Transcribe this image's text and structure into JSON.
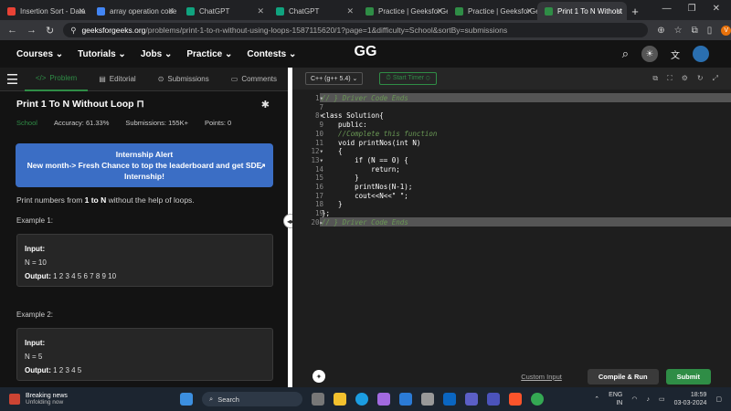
{
  "browser": {
    "tabs": [
      {
        "title": "Insertion Sort - Data",
        "color": "#e94235",
        "active": false
      },
      {
        "title": "array operation code",
        "color": "#4285f4",
        "active": false
      },
      {
        "title": "ChatGPT",
        "color": "#10a37f",
        "active": false
      },
      {
        "title": "ChatGPT",
        "color": "#10a37f",
        "active": false
      },
      {
        "title": "Practice | GeeksforGe",
        "color": "#2f8d46",
        "active": false
      },
      {
        "title": "Practice | GeeksforGe",
        "color": "#2f8d46",
        "active": false
      },
      {
        "title": "Print 1 To N Without",
        "color": "#2f8d46",
        "active": true
      }
    ],
    "new_tab": "+",
    "url_host": "geeksforgeeks.org",
    "url_path": "/problems/print-1-to-n-without-using-loops-1587115620/1?page=1&difficulty=School&sortBy=submissions",
    "profile_letter": "V"
  },
  "gfg": {
    "nav": [
      "Courses ⌄",
      "Tutorials ⌄",
      "Jobs ⌄",
      "Practice ⌄",
      "Contests ⌄"
    ],
    "logo": "GG"
  },
  "problem": {
    "tabs": [
      "Problem",
      "Editorial",
      "Submissions",
      "Comments"
    ],
    "title": "Print 1 To N Without Loop",
    "level": "School",
    "accuracy": "Accuracy: 61.33%",
    "submissions": "Submissions: 155K+",
    "points": "Points: 0",
    "alert_title": "Internship Alert",
    "alert_body": "New month-> Fresh Chance to top the leaderboard and get SDE Internship!",
    "desc_pre": "Print numbers from ",
    "desc_bold": "1 to N",
    "desc_post": " without the help of loops.",
    "example1_heading": "Example 1:",
    "example1_input_label": "Input:",
    "example1_input": "N = 10",
    "example1_output_label": "Output:",
    "example1_output": "1 2 3 4 5 6 7 8 9 10",
    "example2_heading": "Example 2:",
    "example2_input_label": "Input:",
    "example2_input": "N = 5",
    "example2_output_label": "Output:",
    "example2_output": "1 2 3 4 5"
  },
  "editor": {
    "language": "C++ (g++ 5.4)",
    "timer": "Start Timer",
    "lines": [
      {
        "n": "1",
        "fold": "▾",
        "text": "// } Driver Code Ends",
        "kind": "hl"
      },
      {
        "n": "7",
        "fold": "",
        "text": "",
        "kind": "code"
      },
      {
        "n": "8",
        "fold": "▾",
        "text": "class Solution{",
        "kind": "code"
      },
      {
        "n": "9",
        "fold": "",
        "text": "    public:",
        "kind": "code"
      },
      {
        "n": "10",
        "fold": "",
        "text": "    //Complete this function",
        "kind": "cm"
      },
      {
        "n": "11",
        "fold": "",
        "text": "    void printNos(int N)",
        "kind": "code"
      },
      {
        "n": "12",
        "fold": "▾",
        "text": "    {",
        "kind": "code"
      },
      {
        "n": "13",
        "fold": "▾",
        "text": "        if (N == 0) {",
        "kind": "code"
      },
      {
        "n": "14",
        "fold": "",
        "text": "            return;",
        "kind": "code"
      },
      {
        "n": "15",
        "fold": "",
        "text": "        }",
        "kind": "code"
      },
      {
        "n": "16",
        "fold": "",
        "text": "        printNos(N-1);",
        "kind": "code"
      },
      {
        "n": "17",
        "fold": "",
        "text": "        cout<<N<<\" \";",
        "kind": "code"
      },
      {
        "n": "18",
        "fold": "",
        "text": "    }",
        "kind": "code"
      },
      {
        "n": "19",
        "fold": "",
        "text": "};",
        "kind": "code"
      },
      {
        "n": "20",
        "fold": "▸",
        "text": "// } Driver Code Ends",
        "kind": "hl"
      }
    ],
    "custom_input": "Custom Input",
    "compile_run": "Compile & Run",
    "submit": "Submit"
  },
  "taskbar": {
    "news_title": "Breaking news",
    "news_sub": "Unfolding now",
    "search": "Search",
    "lang": "ENG",
    "region": "IN",
    "time": "18:59",
    "date": "03-03-2024"
  }
}
